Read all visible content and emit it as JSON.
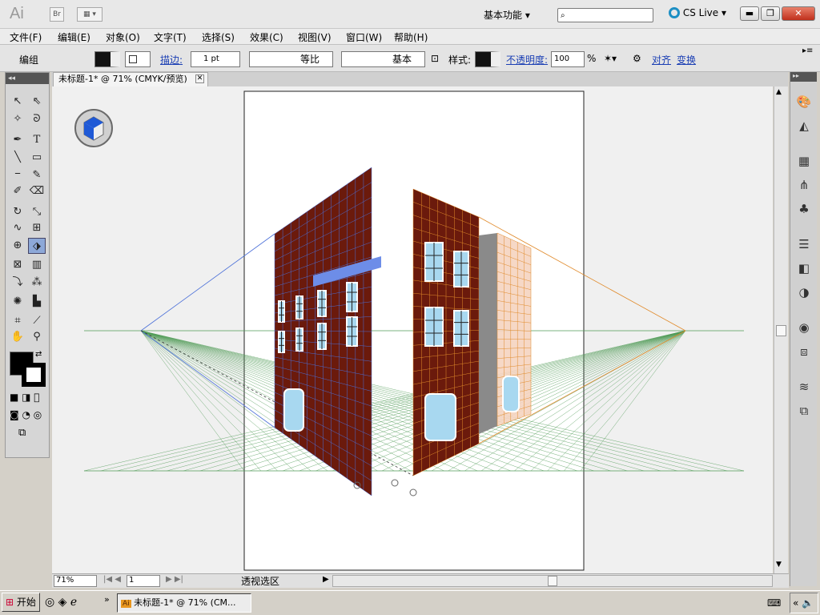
{
  "titlebar": {
    "br_label": "Br",
    "workspace": "基本功能",
    "search_placeholder": "",
    "cslive": "CS Live"
  },
  "menu": [
    "文件(F)",
    "编辑(E)",
    "对象(O)",
    "文字(T)",
    "选择(S)",
    "效果(C)",
    "视图(V)",
    "窗口(W)",
    "帮助(H)"
  ],
  "control": {
    "group_label": "编组",
    "stroke_label": "描边:",
    "stroke_weight": "1 pt",
    "profile_label": "等比",
    "brush_label": "基本",
    "style_label": "样式:",
    "opacity_label": "不透明度:",
    "opacity_value": "100",
    "percent": "%",
    "align_label": "对齐",
    "transform_label": "变换"
  },
  "document": {
    "tab_title": "未标题-1* @ 71% (CMYK/预览)"
  },
  "status": {
    "zoom": "71%",
    "page": "1",
    "tool_name": "透视选区"
  },
  "taskbar": {
    "start": "开始",
    "app_title": "未标题-1* @ 71% (CM..."
  },
  "colors": {
    "brick": "#6b1a0c",
    "left_grid": "#4a6fd8",
    "right_grid": "#e08a2a",
    "ground_grid": "#4f9a56",
    "window_glass": "#a8d8f0"
  },
  "icons": {
    "tools": [
      "selection-icon",
      "direct-selection-icon",
      "magic-wand-icon",
      "lasso-icon",
      "pen-icon",
      "type-icon",
      "line-icon",
      "rectangle-icon",
      "paintbrush-icon",
      "pencil-icon",
      "blob-brush-icon",
      "eraser-icon",
      "rotate-icon",
      "scale-icon",
      "warp-icon",
      "free-transform-icon",
      "shape-builder-icon",
      "perspective-selection-icon",
      "mesh-icon",
      "gradient-icon",
      "eyedropper-icon",
      "blend-icon",
      "symbol-sprayer-icon",
      "graph-icon",
      "artboard-icon",
      "slice-icon",
      "hand-icon",
      "zoom-icon"
    ]
  }
}
